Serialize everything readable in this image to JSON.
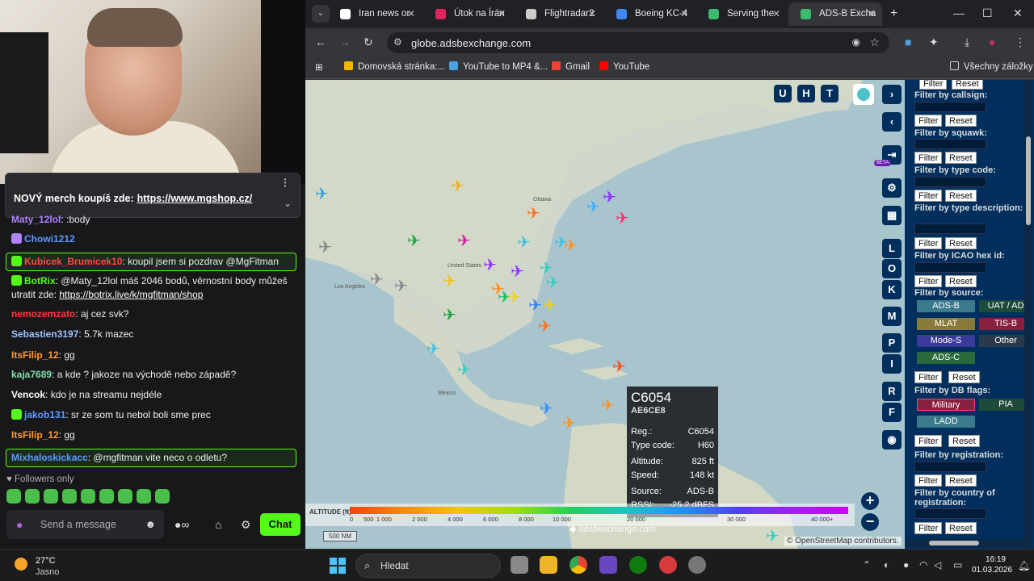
{
  "chat": {
    "pinned_text": "NOVÝ merch koupíš zde:",
    "pinned_link": "https://www.mgshop.cz/",
    "messages": [
      {
        "user": "Maty_12lol",
        "text": ":body",
        "color": "#b084ff"
      },
      {
        "user": "Chowi1212",
        "text": "",
        "color": "#5b9bff"
      },
      {
        "user": "Kubicek_Brumicek10",
        "text": "koupil jsem si pozdrav @MgFitman",
        "color": "#ff4b4b"
      },
      {
        "user": "BotRix",
        "text": "@Maty_12lol máš 2046 bodů, věrnostní body můžeš utratit zde:",
        "link": "https://botrix.live/k/mgfitman/shop",
        "color": "#53fc18"
      },
      {
        "user": "nemozemzato",
        "text": "aj cez svk?",
        "color": "#ff3b3b"
      },
      {
        "user": "Sebastien3197",
        "text": "5.7k mazec",
        "color": "#9ec3ff"
      },
      {
        "user": "ItsFilip_12",
        "text": "gg",
        "color": "#ff9b2e"
      },
      {
        "user": "kaja7689",
        "text": "a kde ? jakoze na východě nebo západě?",
        "color": "#7ee0a8"
      },
      {
        "user": "Vencok",
        "text": "kdo je na streamu nejdéle",
        "color": "#ffffff"
      },
      {
        "user": "jakob131",
        "text": "sr ze som tu nebol boli sme prec",
        "color": "#5b9bff"
      },
      {
        "user": "ItsFilip_12",
        "text": "gg",
        "color": "#ff9b2e"
      },
      {
        "user": "Mixhaloskickacc",
        "text": "@mgfitman vite neco o odletu?",
        "color": "#5b9bff"
      }
    ],
    "followers_only": "Followers only",
    "input_placeholder": "Send a message",
    "chat_button": "Chat",
    "close": "✕"
  },
  "browser": {
    "tabs": [
      {
        "title": "Iran news or",
        "color": "#ffffff"
      },
      {
        "title": "Útok na Írán",
        "color": "#e0245e"
      },
      {
        "title": "Flightradar2",
        "color": "#cccccc"
      },
      {
        "title": "Boeing KC-4",
        "color": "#4285f4"
      },
      {
        "title": "Serving the",
        "color": "#3cba6e"
      },
      {
        "title": "ADS-B Excha",
        "color": "#3cba6e"
      }
    ],
    "url": "globe.adsbexchange.com",
    "bookmarks": [
      {
        "label": "Domovská stránka:...",
        "color": "#f4b400"
      },
      {
        "label": "YouTube to MP4 &...",
        "color": "#4aa3df"
      },
      {
        "label": "Gmail",
        "color": "#ea4335"
      },
      {
        "label": "YouTube",
        "color": "#ff0000"
      }
    ],
    "all_bookmarks": "Všechny záložky"
  },
  "map": {
    "top_buttons": [
      "U",
      "H",
      "T"
    ],
    "side_buttons": [
      "L",
      "O",
      "K",
      "M",
      "P",
      "I",
      "R",
      "F"
    ],
    "beta": "BETA",
    "infobox": {
      "callsign": "C6054",
      "hex": "AE6CE8",
      "rows_a": [
        [
          "Reg.:",
          "C6054"
        ],
        [
          "Type code:",
          "H60"
        ]
      ],
      "rows_b": [
        [
          "Altitude:",
          "825 ft"
        ],
        [
          "Speed:",
          "148 kt"
        ]
      ],
      "rows_c": [
        [
          "Source:",
          "ADS-B"
        ],
        [
          "RSSI:",
          "-25.2 dBFS"
        ]
      ]
    },
    "altitude_label": "ALTITUDE (ft)",
    "altitude_ticks": [
      "0",
      "500",
      "1 000",
      "2 000",
      "4 000",
      "6 000",
      "8 000",
      "10 000",
      "20 000",
      "30 000",
      "40 000+"
    ],
    "scale": "500 NM",
    "logo": "adsbexchange.com",
    "attribution": "© OpenStreetMap contributors.",
    "place_labels": [
      "United States",
      "Ottawa",
      "Mexico",
      "Los Angeles"
    ]
  },
  "sidebar": {
    "filter": "Filter",
    "reset": "Reset",
    "labels": {
      "callsign": "Filter by callsign:",
      "squawk": "Filter by squawk:",
      "type_code": "Filter by type code:",
      "type_desc": "Filter by type description:",
      "icao": "Filter by ICAO hex id:",
      "source": "Filter by source:",
      "db_flags": "Filter by DB flags:",
      "registration": "Filter by registration:",
      "country": "Filter by country of registration:"
    },
    "sources": [
      "ADS-B",
      "UAT / AD",
      "MLAT",
      "TIS-B",
      "Mode-S",
      "Other",
      "ADS-C"
    ],
    "flags": [
      "Military",
      "PIA",
      "LADD"
    ]
  },
  "taskbar": {
    "temp": "27°C",
    "weather": "Jasno",
    "search": "Hledat",
    "time": "16:19",
    "date": "01.03.2026"
  }
}
